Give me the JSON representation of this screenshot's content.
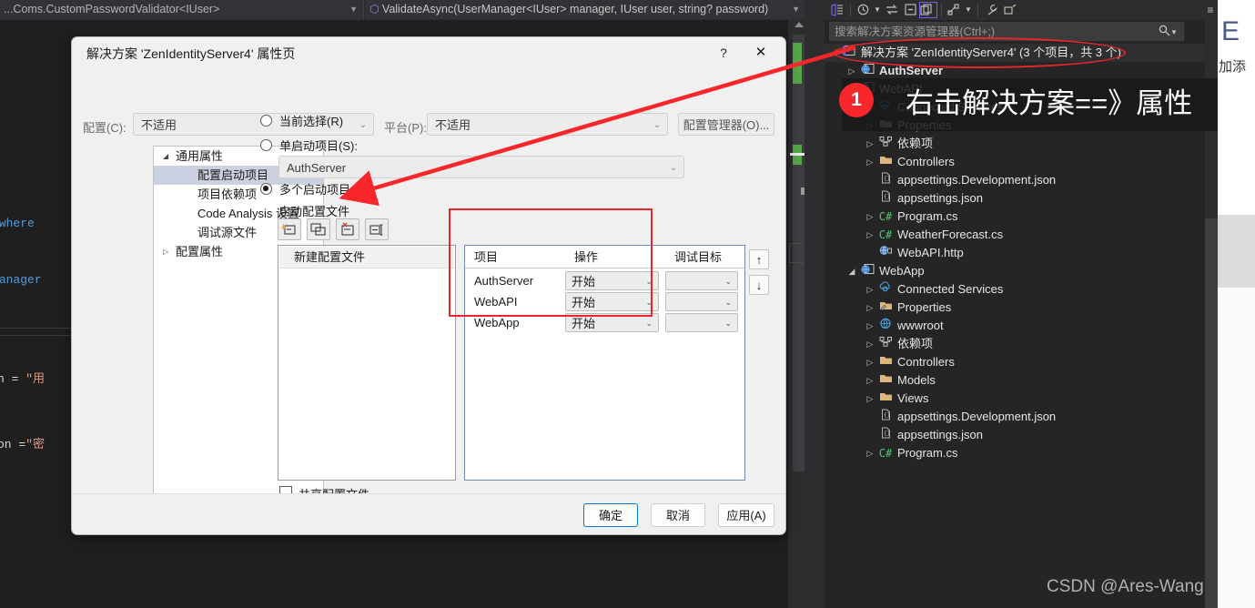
{
  "editor": {
    "context_left": "...Coms.CustomPasswordValidator<IUser>",
    "context_right": "ValidateAsync(UserManager<IUser> manager, IUser user, string? password)",
    "code_fragments": [
      "User> where",
      "ser> manager",
      "iption = \"用",
      "ription =\"密"
    ]
  },
  "solution_explorer": {
    "search_placeholder": "搜索解决方案资源管理器(Ctrl+;)",
    "toolbar_icons": [
      "code-view-icon",
      "pending-changes-icon",
      "sync-icon",
      "collapse-all-icon",
      "show-all-files-icon",
      "properties-nav-icon",
      "wrench-icon",
      "preview-icon"
    ],
    "tree": [
      {
        "label": "解决方案 'ZenIdentityServer4' (3 个项目，共 3 个)",
        "indent": 0,
        "chevron": "",
        "icon": "solution-icon",
        "bold": false,
        "selected": true
      },
      {
        "label": "AuthServer",
        "indent": 1,
        "chevron": "▷",
        "icon": "web-project-icon",
        "bold": true,
        "selected": false
      },
      {
        "label": "WebAPI",
        "indent": 1,
        "chevron": "◢",
        "icon": "web-project-icon",
        "bold": false,
        "selected": false
      },
      {
        "label": "Connected Services",
        "indent": 2,
        "chevron": "▷",
        "icon": "connected-services-icon",
        "bold": false,
        "selected": false
      },
      {
        "label": "Properties",
        "indent": 2,
        "chevron": "▷",
        "icon": "properties-folder-icon",
        "bold": false,
        "selected": false
      },
      {
        "label": "依赖项",
        "indent": 2,
        "chevron": "▷",
        "icon": "dependencies-icon",
        "bold": false,
        "selected": false
      },
      {
        "label": "Controllers",
        "indent": 2,
        "chevron": "▷",
        "icon": "folder-icon",
        "bold": false,
        "selected": false
      },
      {
        "label": "appsettings.Development.json",
        "indent": 2,
        "chevron": "",
        "icon": "json-file-icon",
        "bold": false,
        "selected": false
      },
      {
        "label": "appsettings.json",
        "indent": 2,
        "chevron": "",
        "icon": "json-file-icon",
        "bold": false,
        "selected": false
      },
      {
        "label": "Program.cs",
        "indent": 2,
        "chevron": "▷",
        "icon": "csharp-file-icon",
        "bold": false,
        "selected": false
      },
      {
        "label": "WeatherForecast.cs",
        "indent": 2,
        "chevron": "▷",
        "icon": "csharp-file-icon",
        "bold": false,
        "selected": false
      },
      {
        "label": "WebAPI.http",
        "indent": 2,
        "chevron": "",
        "icon": "http-file-icon",
        "bold": false,
        "selected": false
      },
      {
        "label": "WebApp",
        "indent": 1,
        "chevron": "◢",
        "icon": "web-project-icon",
        "bold": false,
        "selected": false
      },
      {
        "label": "Connected Services",
        "indent": 2,
        "chevron": "▷",
        "icon": "connected-services-icon",
        "bold": false,
        "selected": false
      },
      {
        "label": "Properties",
        "indent": 2,
        "chevron": "▷",
        "icon": "properties-folder-icon",
        "bold": false,
        "selected": false
      },
      {
        "label": "wwwroot",
        "indent": 2,
        "chevron": "▷",
        "icon": "wwwroot-icon",
        "bold": false,
        "selected": false
      },
      {
        "label": "依赖项",
        "indent": 2,
        "chevron": "▷",
        "icon": "dependencies-icon",
        "bold": false,
        "selected": false
      },
      {
        "label": "Controllers",
        "indent": 2,
        "chevron": "▷",
        "icon": "folder-icon",
        "bold": false,
        "selected": false
      },
      {
        "label": "Models",
        "indent": 2,
        "chevron": "▷",
        "icon": "folder-icon",
        "bold": false,
        "selected": false
      },
      {
        "label": "Views",
        "indent": 2,
        "chevron": "▷",
        "icon": "folder-icon",
        "bold": false,
        "selected": false
      },
      {
        "label": "appsettings.Development.json",
        "indent": 2,
        "chevron": "",
        "icon": "json-file-icon",
        "bold": false,
        "selected": false
      },
      {
        "label": "appsettings.json",
        "indent": 2,
        "chevron": "",
        "icon": "json-file-icon",
        "bold": false,
        "selected": false
      },
      {
        "label": "Program.cs",
        "indent": 2,
        "chevron": "▷",
        "icon": "csharp-file-icon",
        "bold": false,
        "selected": false
      }
    ]
  },
  "dialog": {
    "title": "解决方案 'ZenIdentityServer4' 属性页",
    "help_glyph": "?",
    "close_glyph": "✕",
    "config_label": "配置(C):",
    "config_value": "不适用",
    "platform_label": "平台(P):",
    "platform_value": "不适用",
    "config_manager_button": "配置管理器(O)...",
    "nav_items": [
      {
        "label": "通用属性",
        "level": 0,
        "tri": "◢",
        "selected": false
      },
      {
        "label": "配置启动项目",
        "level": 1,
        "tri": "",
        "selected": true
      },
      {
        "label": "项目依赖项",
        "level": 1,
        "tri": "",
        "selected": false
      },
      {
        "label": "Code Analysis 设置",
        "level": 1,
        "tri": "",
        "selected": false
      },
      {
        "label": "调试源文件",
        "level": 1,
        "tri": "",
        "selected": false
      },
      {
        "label": "配置属性",
        "level": 0,
        "tri": "▷",
        "selected": false
      }
    ],
    "radio_current": "当前选择(R)",
    "radio_single": "单启动项目(S):",
    "single_project_value": "AuthServer",
    "radio_multiple": "多个启动项目(M):",
    "selected_radio": "multiple",
    "profiles_label": "启动配置文件",
    "profile_tool_icons": [
      "new-profile-icon",
      "copy-profile-icon",
      "delete-profile-icon",
      "rename-profile-icon"
    ],
    "profile_list": [
      "新建配置文件"
    ],
    "share_profile_label": "共享配置文件",
    "share_profile_checked": false,
    "grid_headers": [
      "项目",
      "操作",
      "调试目标"
    ],
    "grid_rows": [
      {
        "project": "AuthServer",
        "action": "开始",
        "debug_target": ""
      },
      {
        "project": "WebAPI",
        "action": "开始",
        "debug_target": ""
      },
      {
        "project": "WebApp",
        "action": "开始",
        "debug_target": ""
      }
    ],
    "move_up_glyph": "↑",
    "move_down_glyph": "↓",
    "ok_button": "确定",
    "cancel_button": "取消",
    "apply_button": "应用(A)"
  },
  "annotations": {
    "step_number": "1",
    "callout_text": "右击解决方案==》属性",
    "watermark": "CSDN @Ares-Wang"
  },
  "right_strip": {
    "big_letter": "E",
    "small_text": "加添"
  },
  "colors": {
    "accent_red": "#e8262b",
    "badge_red": "#f7272c",
    "dialog_bg": "#f0f0f0",
    "ide_bg": "#1f1f1f",
    "panel_bg": "#252526",
    "grid_border": "#6e8bb5"
  }
}
